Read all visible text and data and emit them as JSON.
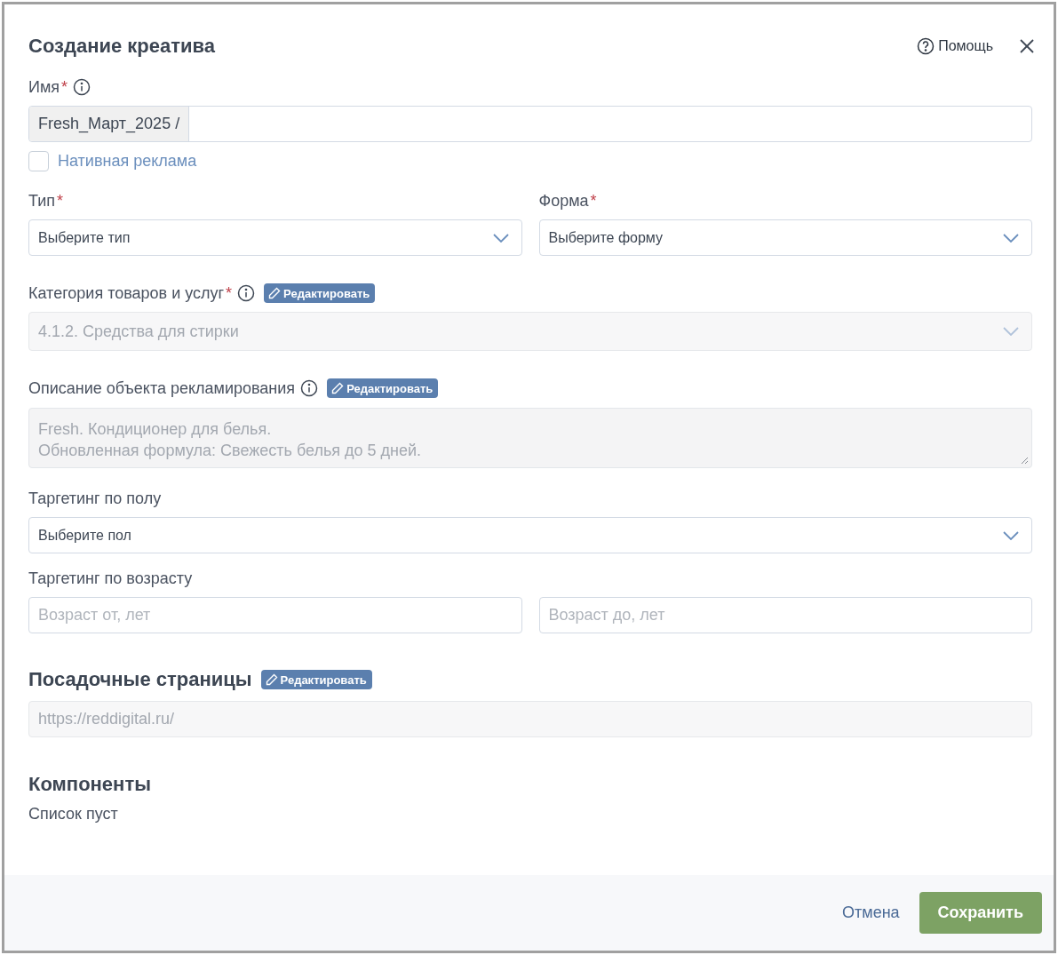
{
  "title": "Создание креатива",
  "help": {
    "label": "Помощь"
  },
  "name_field": {
    "label": "Имя",
    "required_mark": "*",
    "info": true,
    "prefix": "Fresh_Март_2025 /"
  },
  "native_ad": {
    "label": "Нативная реклама",
    "checked": false
  },
  "type_select": {
    "label": "Тип",
    "required_mark": "*",
    "placeholder": "Выберите тип"
  },
  "form_select": {
    "label": "Форма",
    "required_mark": "*",
    "placeholder": "Выберите форму"
  },
  "category": {
    "label": "Категория товаров и услуг",
    "required_mark": "*",
    "info": true,
    "edit_label": "Редактировать",
    "value": "4.1.2. Средства для стирки",
    "disabled": true
  },
  "description": {
    "label": "Описание объекта рекламирования",
    "info": true,
    "edit_label": "Редактировать",
    "lines": [
      "Fresh. Кондиционер для белья.",
      "Обновленная формула: Свежесть белья до 5 дней."
    ],
    "disabled": true
  },
  "gender_select": {
    "label": "Таргетинг по полу",
    "placeholder": "Выберите пол"
  },
  "age": {
    "label": "Таргетинг по возрасту",
    "from_placeholder": "Возраст от, лет",
    "to_placeholder": "Возраст до, лет"
  },
  "landing": {
    "title": "Посадочные страницы",
    "edit_label": "Редактировать",
    "value": "https://reddigital.ru/",
    "disabled": true
  },
  "components": {
    "title": "Компоненты",
    "empty_text": "Список пуст"
  },
  "footer": {
    "cancel": "Отмена",
    "save": "Сохранить"
  }
}
